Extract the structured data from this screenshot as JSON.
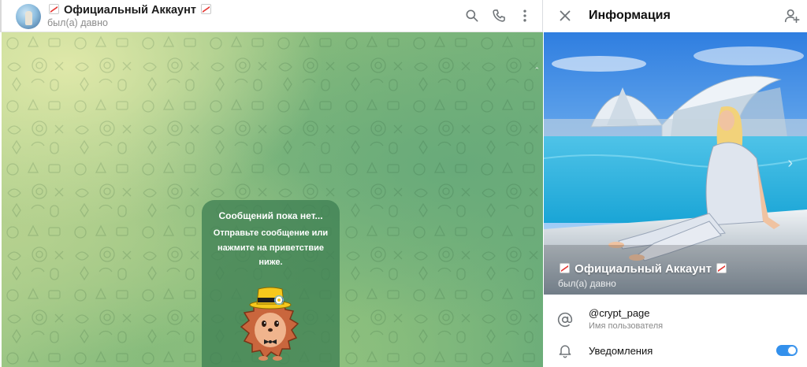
{
  "chat": {
    "title": "Официальный Аккаунт",
    "status": "был(а) давно",
    "icons": [
      "search-icon",
      "phone-icon",
      "more-vertical-icon"
    ],
    "empty_state": {
      "title": "Сообщений пока нет...",
      "text": "Отправьте сообщение или нажмите на приветствие ниже.",
      "sticker": "hedgehog-hat-sticker"
    }
  },
  "info": {
    "title": "Информация",
    "profile_name": "Официальный Аккаунт",
    "profile_status": "был(а) давно",
    "username": "@crypt_page",
    "username_label": "Имя пользователя",
    "notifications_label": "Уведомления",
    "notifications_enabled": true
  },
  "colors": {
    "accent": "#3390ec",
    "card": "#3f8053",
    "icon": "#707579"
  }
}
